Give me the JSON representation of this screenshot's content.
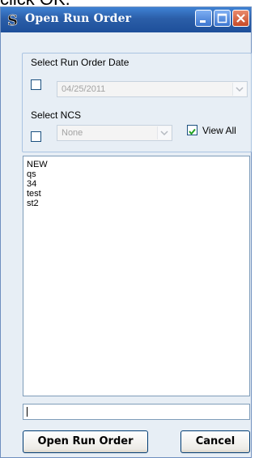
{
  "top_text": "click OK.",
  "window": {
    "title": "Open Run Order",
    "title_icon": "wizard-s-icon"
  },
  "date_section": {
    "label": "Select Run Order Date",
    "checked": false,
    "date_value": "04/25/2011"
  },
  "ncs_section": {
    "label": "Select NCS",
    "checked": false,
    "ncs_value": "None",
    "view_all_label": "View All",
    "view_all_checked": true
  },
  "list": {
    "items": [
      "NEW",
      "qs",
      "34",
      "test",
      "st2"
    ]
  },
  "name_input": {
    "value": ""
  },
  "buttons": {
    "open_label": "Open Run Order",
    "cancel_label": "Cancel"
  }
}
